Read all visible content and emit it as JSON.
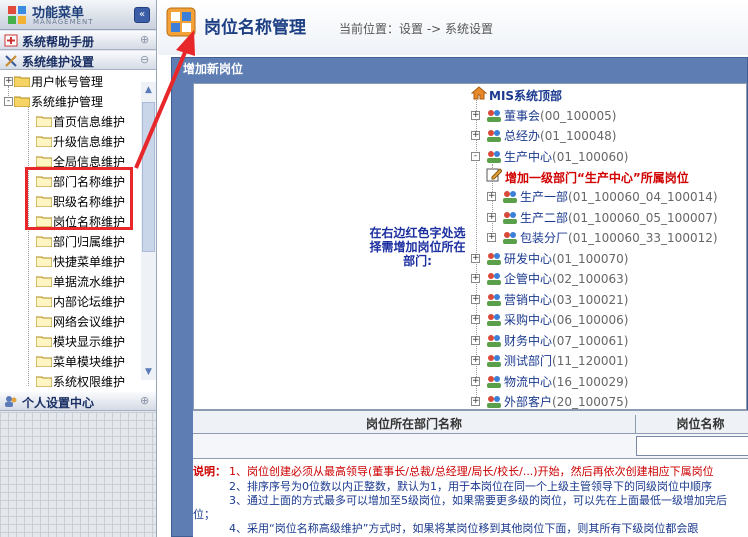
{
  "sidebar": {
    "title": "功能菜单",
    "subtitle": "MANAGEMENT",
    "collapse_glyph": "«",
    "sections": [
      {
        "label": "系统帮助手册",
        "toggle": "⊕",
        "icon": "help-icon"
      },
      {
        "label": "系统维护设置",
        "toggle": "⊖",
        "icon": "tools-icon"
      },
      {
        "label": "个人设置中心",
        "toggle": "⊕",
        "icon": "users-icon"
      }
    ],
    "tree": {
      "groups": [
        {
          "label": "用户帐号管理",
          "expander": "+"
        },
        {
          "label": "系统维护管理",
          "expander": "-"
        }
      ],
      "items": [
        {
          "label": "首页信息维护"
        },
        {
          "label": "升级信息维护"
        },
        {
          "label": "全局信息维护"
        },
        {
          "label": "部门名称维护"
        },
        {
          "label": "职级名称维护"
        },
        {
          "label": "岗位名称维护"
        },
        {
          "label": "部门归属维护"
        },
        {
          "label": "快捷菜单维护"
        },
        {
          "label": "单据流水维护"
        },
        {
          "label": "内部论坛维护"
        },
        {
          "label": "网络会议维护"
        },
        {
          "label": "模块显示维护"
        },
        {
          "label": "菜单模块维护"
        },
        {
          "label": "系统权限维护"
        }
      ]
    }
  },
  "header": {
    "page_title": "岗位名称管理",
    "breadcrumb": "当前位置：设置 -> 系统设置"
  },
  "panel": {
    "title": "增加新岗位",
    "prompt": "在右边红色字处选择需增加岗位所在部门:",
    "tree_root": "MIS系统顶部",
    "add_label": "增加一级部门“生产中心”所属岗位",
    "orgs": [
      {
        "name": "董事会",
        "code": "(00_100005)"
      },
      {
        "name": "总经办",
        "code": "(01_100048)"
      },
      {
        "name": "生产中心",
        "code": "(01_100060)"
      },
      {
        "name": "生产一部",
        "code": "(01_100060_04_100014)"
      },
      {
        "name": "生产二部",
        "code": "(01_100060_05_100007)"
      },
      {
        "name": "包装分厂",
        "code": "(01_100060_33_100012)"
      },
      {
        "name": "研发中心",
        "code": "(01_100070)"
      },
      {
        "name": "企管中心",
        "code": "(02_100063)"
      },
      {
        "name": "营销中心",
        "code": "(03_100021)"
      },
      {
        "name": "采购中心",
        "code": "(06_100006)"
      },
      {
        "name": "财务中心",
        "code": "(07_100061)"
      },
      {
        "name": "测试部门",
        "code": "(11_120001)"
      },
      {
        "name": "物流中心",
        "code": "(16_100029)"
      },
      {
        "name": "外部客户",
        "code": "(20_100075)"
      }
    ],
    "table": {
      "col1": "岗位所在部门名称",
      "col2": "岗位名称"
    }
  },
  "notes": {
    "prefix": "说明：",
    "lines": [
      "1、岗位创建必须从最高领导(董事长/总裁/总经理/局长/校长/...)开始，然后再依次创建相应下属岗位",
      "2、排序序号为0位数以内正整数，默认为1，用于本岗位在同一个上级主管领导下的同级岗位中顺序",
      "3、通过上面的方式最多可以增加至5级岗位，如果需要更多级的岗位，可以先在上面最低一级增加完后",
      "位；",
      "4、采用“岗位名称高级维护”方式时，如果将某岗位移到其他岗位下面，则其所有下级岗位都会跟"
    ]
  },
  "colors": {
    "annotation_red": "#e8272a",
    "panel_blue": "#5e7eb3",
    "title_blue": "#1d3f84",
    "note_red": "#cc0000"
  }
}
